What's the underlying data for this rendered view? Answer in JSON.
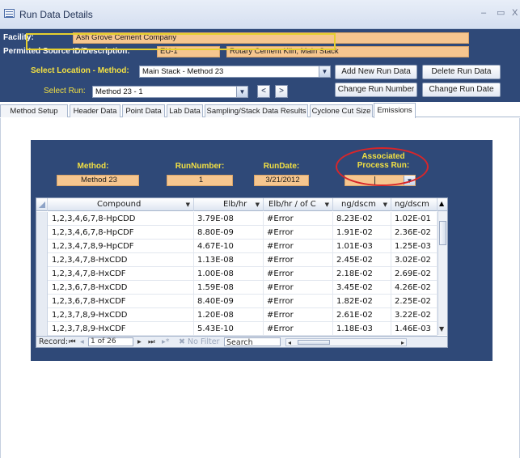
{
  "window": {
    "title": "Run Data Details",
    "minimize": "–",
    "maximize": "▭",
    "close": "X"
  },
  "header": {
    "facility_label": "Facility:",
    "facility_value": "Ash Grove Cement Company",
    "permitted_label": "Permitted Source ID/Description:",
    "source_id": "EU-1",
    "source_desc": "Rotary Cement Kiln, Main Stack",
    "location_label": "Select Location - Method:",
    "location_value": "Main Stack - Method 23",
    "run_label": "Select Run:",
    "run_value": "Method 23 - 1",
    "prev_label": "<",
    "next_label": ">",
    "buttons": {
      "add_new_run": "Add New Run Data",
      "delete_run": "Delete Run Data",
      "change_run_number": "Change Run Number",
      "change_run_date": "Change Run Date"
    }
  },
  "tabs": [
    "Method Setup",
    "Header Data",
    "Point Data",
    "Lab Data",
    "Sampling/Stack Data Results",
    "Cyclone Cut Size",
    "Emissions"
  ],
  "active_tab": "Emissions",
  "emissions": {
    "method_label": "Method:",
    "method_value": "Method 23",
    "runnumber_label": "RunNumber:",
    "runnumber_value": "1",
    "rundate_label": "RunDate:",
    "rundate_value": "3/21/2012",
    "process_run_label_line1": "Associated",
    "process_run_label_line2": "Process Run:",
    "process_run_value": ""
  },
  "grid": {
    "columns": [
      "Compound",
      "Elb/hr",
      "Elb/hr / of C",
      "ng/dscm",
      "ng/dscm"
    ],
    "rows": [
      [
        "1,2,3,4,6,7,8-HpCDD",
        "3.79E-08",
        "#Error",
        "8.23E-02",
        "1.02E-01"
      ],
      [
        "1,2,3,4,6,7,8-HpCDF",
        "8.80E-09",
        "#Error",
        "1.91E-02",
        "2.36E-02"
      ],
      [
        "1,2,3,4,7,8,9-HpCDF",
        "4.67E-10",
        "#Error",
        "1.01E-03",
        "1.25E-03"
      ],
      [
        "1,2,3,4,7,8-HxCDD",
        "1.13E-08",
        "#Error",
        "2.45E-02",
        "3.02E-02"
      ],
      [
        "1,2,3,4,7,8-HxCDF",
        "1.00E-08",
        "#Error",
        "2.18E-02",
        "2.69E-02"
      ],
      [
        "1,2,3,6,7,8-HxCDD",
        "1.59E-08",
        "#Error",
        "3.45E-02",
        "4.26E-02"
      ],
      [
        "1,2,3,6,7,8-HxCDF",
        "8.40E-09",
        "#Error",
        "1.82E-02",
        "2.25E-02"
      ],
      [
        "1,2,3,7,8,9-HxCDD",
        "1.20E-08",
        "#Error",
        "2.61E-02",
        "3.22E-02"
      ],
      [
        "1,2,3,7,8,9-HxCDF",
        "5.43E-10",
        "#Error",
        "1.18E-03",
        "1.46E-03"
      ]
    ]
  },
  "record_nav": {
    "record_label": "Record:",
    "first": "⏮",
    "prev": "◂",
    "position": "1 of 26",
    "next": "▸",
    "last": "⏭",
    "new": "▸*",
    "filter_label": "No Filter",
    "search_label": "Search"
  },
  "colors": {
    "header_bg": "#2f4978",
    "label_yellow": "#f2e043",
    "field_orange": "#f6c68f",
    "highlight_red": "#d8262a"
  }
}
